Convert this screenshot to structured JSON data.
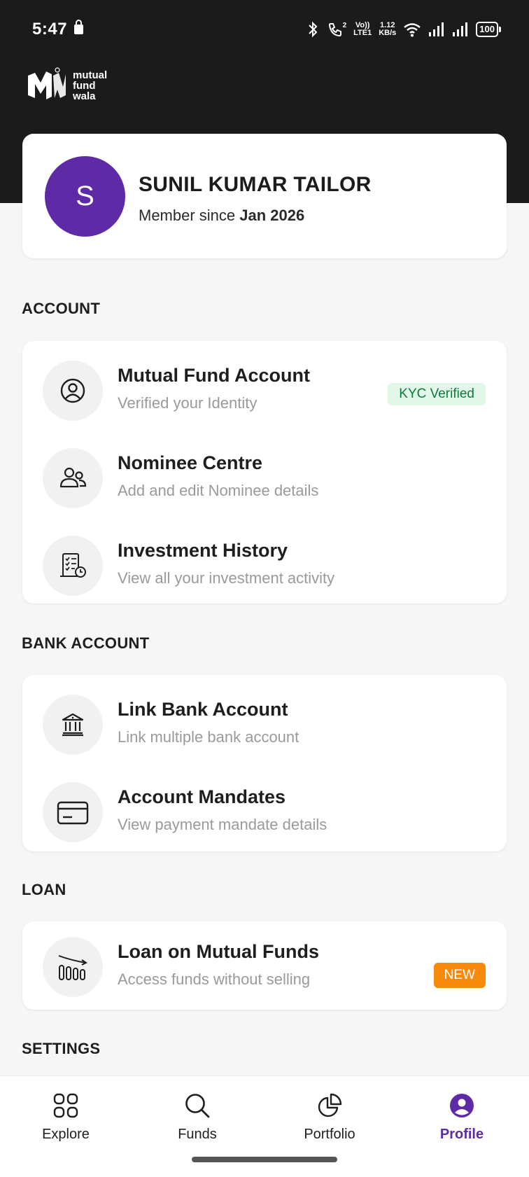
{
  "status_bar": {
    "time": "5:47",
    "network_speed_value": "1.12",
    "network_speed_unit": "KB/s",
    "volte_top": "Vo))",
    "volte_bottom": "LTE1",
    "call_sim": "2",
    "battery": "100"
  },
  "brand": {
    "line1": "mutual",
    "line2": "fund",
    "line3": "wala"
  },
  "profile": {
    "avatar_initial": "S",
    "name": "SUNIL KUMAR TAILOR",
    "member_since_label": "Member since ",
    "member_since_date": "Jan 2026"
  },
  "sections": {
    "account": {
      "title": "ACCOUNT",
      "items": [
        {
          "title": "Mutual Fund Account",
          "subtitle": "Verified your Identity",
          "badge": "KYC Verified",
          "icon": "user-circle-icon"
        },
        {
          "title": "Nominee Centre",
          "subtitle": "Add and edit Nominee details",
          "icon": "users-icon"
        },
        {
          "title": "Investment History",
          "subtitle": "View all your investment activity",
          "icon": "history-report-icon"
        }
      ]
    },
    "bank": {
      "title": "BANK ACCOUNT",
      "items": [
        {
          "title": "Link Bank Account",
          "subtitle": "Link multiple bank account",
          "icon": "bank-icon"
        },
        {
          "title": "Account Mandates",
          "subtitle": "View payment mandate details",
          "icon": "card-icon"
        }
      ]
    },
    "loan": {
      "title": "LOAN",
      "items": [
        {
          "title": "Loan on Mutual Funds",
          "subtitle": "Access funds without selling",
          "badge": "NEW",
          "icon": "declining-chart-icon"
        }
      ]
    },
    "settings": {
      "title": "SETTINGS"
    }
  },
  "bottom_nav": [
    {
      "label": "Explore",
      "icon": "grid-icon",
      "active": false
    },
    {
      "label": "Funds",
      "icon": "search-icon",
      "active": false
    },
    {
      "label": "Portfolio",
      "icon": "pie-chart-icon",
      "active": false
    },
    {
      "label": "Profile",
      "icon": "profile-icon",
      "active": true
    }
  ],
  "colors": {
    "header_bg": "#1b1b1b",
    "accent": "#5f2aa5",
    "kyc_badge_bg": "#e2f7ea",
    "kyc_badge_text": "#0e7a3c",
    "new_badge_bg": "#f7890b"
  }
}
